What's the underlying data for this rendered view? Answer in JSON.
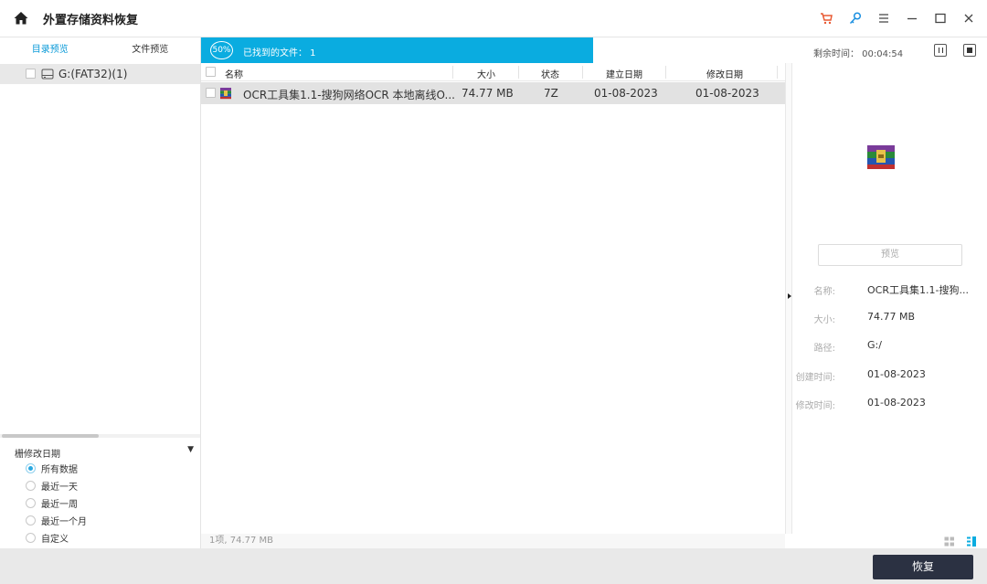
{
  "app": {
    "title": "外置存储资料恢复",
    "colors": {
      "accent": "#0aace0",
      "cart": "#e85a33",
      "key": "#1a8fe0",
      "recover_btn": "#2b3142"
    }
  },
  "left": {
    "tabs": [
      {
        "label": "目录预览",
        "active": true
      },
      {
        "label": "文件预览",
        "active": false
      }
    ],
    "tree": [
      {
        "label": "G:(FAT32)(1)",
        "icon": "drive-icon"
      }
    ],
    "filter": {
      "title": "栅修改日期",
      "options": [
        {
          "label": "所有数据",
          "selected": true
        },
        {
          "label": "最近一天",
          "selected": false
        },
        {
          "label": "最近一周",
          "selected": false
        },
        {
          "label": "最近一个月",
          "selected": false
        },
        {
          "label": "自定义",
          "selected": false
        }
      ]
    }
  },
  "scan": {
    "percent_label": "50%",
    "percent": 50,
    "found_label": "已找到的文件： 1",
    "remaining_label": "剩余时间： 00:04:54"
  },
  "table": {
    "headers": {
      "name": "名称",
      "size": "大小",
      "status": "状态",
      "created": "建立日期",
      "modified": "修改日期"
    },
    "rows": [
      {
        "name": "OCR工具集1.1-搜狗网络OCR 本地离线O...",
        "size": "74.77  MB",
        "status": "7Z",
        "created": "01-08-2023",
        "modified": "01-08-2023"
      }
    ],
    "summary": "1项, 74.77 MB"
  },
  "details": {
    "preview_label": "预览",
    "fields": [
      {
        "key": "名称:",
        "value": "OCR工具集1.1-搜狗..."
      },
      {
        "key": "大小:",
        "value": "74.77  MB"
      },
      {
        "key": "路径:",
        "value": "G:/"
      },
      {
        "key": "创建时间:",
        "value": "01-08-2023"
      },
      {
        "key": "修改时间:",
        "value": "01-08-2023"
      }
    ]
  },
  "footer": {
    "recover_label": "恢复"
  }
}
